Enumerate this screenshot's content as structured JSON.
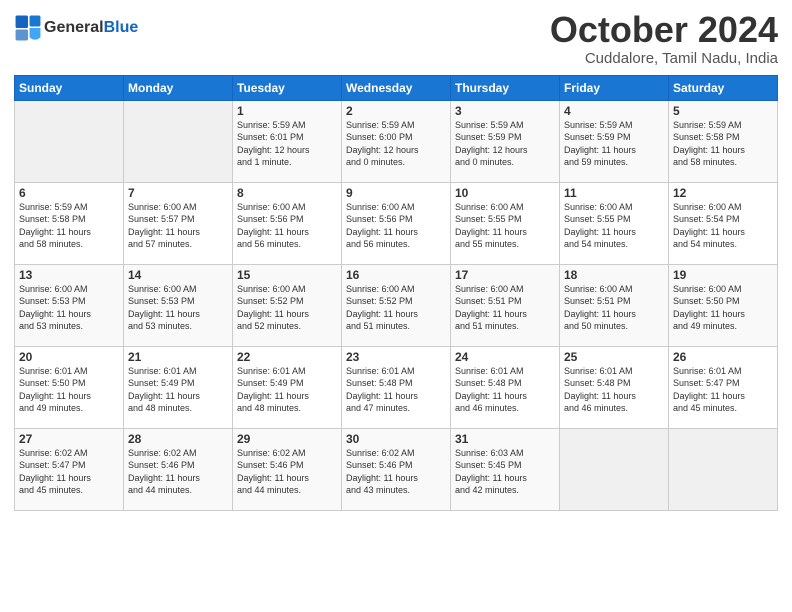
{
  "logo": {
    "general": "General",
    "blue": "Blue"
  },
  "title": "October 2024",
  "location": "Cuddalore, Tamil Nadu, India",
  "weekdays": [
    "Sunday",
    "Monday",
    "Tuesday",
    "Wednesday",
    "Thursday",
    "Friday",
    "Saturday"
  ],
  "weeks": [
    [
      {
        "day": "",
        "info": ""
      },
      {
        "day": "",
        "info": ""
      },
      {
        "day": "1",
        "info": "Sunrise: 5:59 AM\nSunset: 6:01 PM\nDaylight: 12 hours\nand 1 minute."
      },
      {
        "day": "2",
        "info": "Sunrise: 5:59 AM\nSunset: 6:00 PM\nDaylight: 12 hours\nand 0 minutes."
      },
      {
        "day": "3",
        "info": "Sunrise: 5:59 AM\nSunset: 5:59 PM\nDaylight: 12 hours\nand 0 minutes."
      },
      {
        "day": "4",
        "info": "Sunrise: 5:59 AM\nSunset: 5:59 PM\nDaylight: 11 hours\nand 59 minutes."
      },
      {
        "day": "5",
        "info": "Sunrise: 5:59 AM\nSunset: 5:58 PM\nDaylight: 11 hours\nand 58 minutes."
      }
    ],
    [
      {
        "day": "6",
        "info": "Sunrise: 5:59 AM\nSunset: 5:58 PM\nDaylight: 11 hours\nand 58 minutes."
      },
      {
        "day": "7",
        "info": "Sunrise: 6:00 AM\nSunset: 5:57 PM\nDaylight: 11 hours\nand 57 minutes."
      },
      {
        "day": "8",
        "info": "Sunrise: 6:00 AM\nSunset: 5:56 PM\nDaylight: 11 hours\nand 56 minutes."
      },
      {
        "day": "9",
        "info": "Sunrise: 6:00 AM\nSunset: 5:56 PM\nDaylight: 11 hours\nand 56 minutes."
      },
      {
        "day": "10",
        "info": "Sunrise: 6:00 AM\nSunset: 5:55 PM\nDaylight: 11 hours\nand 55 minutes."
      },
      {
        "day": "11",
        "info": "Sunrise: 6:00 AM\nSunset: 5:55 PM\nDaylight: 11 hours\nand 54 minutes."
      },
      {
        "day": "12",
        "info": "Sunrise: 6:00 AM\nSunset: 5:54 PM\nDaylight: 11 hours\nand 54 minutes."
      }
    ],
    [
      {
        "day": "13",
        "info": "Sunrise: 6:00 AM\nSunset: 5:53 PM\nDaylight: 11 hours\nand 53 minutes."
      },
      {
        "day": "14",
        "info": "Sunrise: 6:00 AM\nSunset: 5:53 PM\nDaylight: 11 hours\nand 53 minutes."
      },
      {
        "day": "15",
        "info": "Sunrise: 6:00 AM\nSunset: 5:52 PM\nDaylight: 11 hours\nand 52 minutes."
      },
      {
        "day": "16",
        "info": "Sunrise: 6:00 AM\nSunset: 5:52 PM\nDaylight: 11 hours\nand 51 minutes."
      },
      {
        "day": "17",
        "info": "Sunrise: 6:00 AM\nSunset: 5:51 PM\nDaylight: 11 hours\nand 51 minutes."
      },
      {
        "day": "18",
        "info": "Sunrise: 6:00 AM\nSunset: 5:51 PM\nDaylight: 11 hours\nand 50 minutes."
      },
      {
        "day": "19",
        "info": "Sunrise: 6:00 AM\nSunset: 5:50 PM\nDaylight: 11 hours\nand 49 minutes."
      }
    ],
    [
      {
        "day": "20",
        "info": "Sunrise: 6:01 AM\nSunset: 5:50 PM\nDaylight: 11 hours\nand 49 minutes."
      },
      {
        "day": "21",
        "info": "Sunrise: 6:01 AM\nSunset: 5:49 PM\nDaylight: 11 hours\nand 48 minutes."
      },
      {
        "day": "22",
        "info": "Sunrise: 6:01 AM\nSunset: 5:49 PM\nDaylight: 11 hours\nand 48 minutes."
      },
      {
        "day": "23",
        "info": "Sunrise: 6:01 AM\nSunset: 5:48 PM\nDaylight: 11 hours\nand 47 minutes."
      },
      {
        "day": "24",
        "info": "Sunrise: 6:01 AM\nSunset: 5:48 PM\nDaylight: 11 hours\nand 46 minutes."
      },
      {
        "day": "25",
        "info": "Sunrise: 6:01 AM\nSunset: 5:48 PM\nDaylight: 11 hours\nand 46 minutes."
      },
      {
        "day": "26",
        "info": "Sunrise: 6:01 AM\nSunset: 5:47 PM\nDaylight: 11 hours\nand 45 minutes."
      }
    ],
    [
      {
        "day": "27",
        "info": "Sunrise: 6:02 AM\nSunset: 5:47 PM\nDaylight: 11 hours\nand 45 minutes."
      },
      {
        "day": "28",
        "info": "Sunrise: 6:02 AM\nSunset: 5:46 PM\nDaylight: 11 hours\nand 44 minutes."
      },
      {
        "day": "29",
        "info": "Sunrise: 6:02 AM\nSunset: 5:46 PM\nDaylight: 11 hours\nand 44 minutes."
      },
      {
        "day": "30",
        "info": "Sunrise: 6:02 AM\nSunset: 5:46 PM\nDaylight: 11 hours\nand 43 minutes."
      },
      {
        "day": "31",
        "info": "Sunrise: 6:03 AM\nSunset: 5:45 PM\nDaylight: 11 hours\nand 42 minutes."
      },
      {
        "day": "",
        "info": ""
      },
      {
        "day": "",
        "info": ""
      }
    ]
  ]
}
